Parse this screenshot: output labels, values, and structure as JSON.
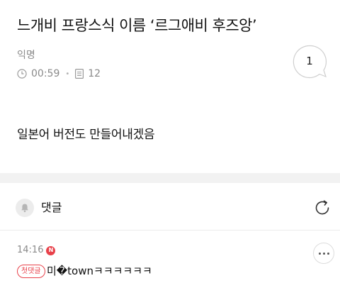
{
  "post": {
    "title": "느개비 프랑스식 이름 ‘르그애비 후즈앙’",
    "author": "익명",
    "time": "00:59",
    "views": "12",
    "comment_count": "1",
    "body": "일본어 버전도 만들어내겠음"
  },
  "comments_section": {
    "label": "댓글"
  },
  "comments": [
    {
      "time": "14:16",
      "new_badge": "N",
      "first_badge": "첫댓글",
      "text": "미�townㅋㅋㅋㅋㅋㅋ"
    }
  ],
  "colors": {
    "accent_red": "#e8414a",
    "meta_gray": "#8a8a8a",
    "divider": "#f2f2f2"
  },
  "icons": [
    "clock-icon",
    "document-icon",
    "comment-bubble-icon",
    "bell-icon",
    "refresh-icon",
    "more-icon"
  ]
}
